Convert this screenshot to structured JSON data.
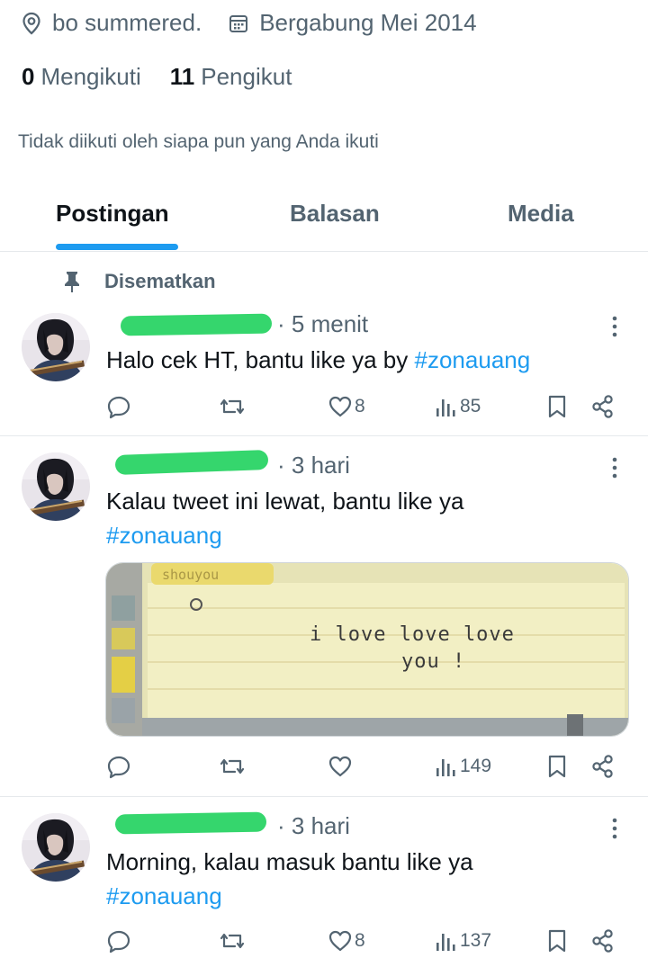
{
  "profile": {
    "location": "bo summered.",
    "joined": "Bergabung Mei 2014",
    "following_count": "0",
    "following_label": "Mengikuti",
    "followers_count": "11",
    "followers_label": "Pengikut",
    "not_followed_text": "Tidak diikuti oleh siapa pun yang Anda ikuti"
  },
  "tabs": [
    {
      "label": "Postingan",
      "active": true
    },
    {
      "label": "Balasan",
      "active": false
    },
    {
      "label": "Media",
      "active": false
    }
  ],
  "pinned_label": "Disematkan",
  "posts": [
    {
      "time": "5 menit",
      "text": "Halo cek HT, bantu like ya by",
      "hashtag": "#zonauang",
      "likes": "8",
      "views": "85"
    },
    {
      "time": "3 hari",
      "text": "Kalau tweet ini lewat, bantu like ya",
      "hashtag": "#zonauang",
      "image_caption_line1": "i love love love",
      "image_caption_line2": "you !",
      "image_tab_text": "shouyou",
      "likes": "",
      "views": "149"
    },
    {
      "time": "3 hari",
      "text": "Morning, kalau masuk bantu like ya",
      "hashtag": "#zonauang",
      "likes": "8",
      "views": "137"
    }
  ],
  "icons": {
    "location": "location-pin-icon",
    "calendar": "calendar-icon",
    "pin": "pin-icon",
    "more": "more-vertical-icon",
    "reply": "reply-icon",
    "repost": "repost-icon",
    "like": "heart-icon",
    "views": "views-chart-icon",
    "bookmark": "bookmark-icon",
    "share": "share-icon"
  },
  "colors": {
    "accent": "#1d9bf0",
    "text_primary": "#0f1419",
    "text_secondary": "#536471",
    "redaction": "#35d66d"
  }
}
